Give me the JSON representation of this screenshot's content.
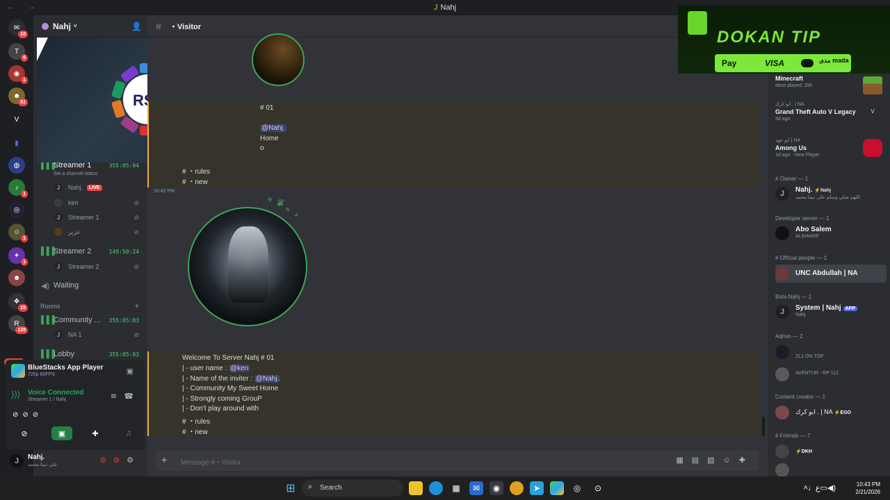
{
  "window": {
    "title": "Nahj"
  },
  "guild_badges": [
    "18",
    "6",
    "1",
    "61",
    "1",
    "1",
    "1",
    "15",
    "128"
  ],
  "guild_letter": "V",
  "guild_new": "NEW",
  "server": {
    "name": "Nahj"
  },
  "overlay": {
    "logo_text": "RSL"
  },
  "channels": {
    "streamer1": {
      "name": "Streamer 1",
      "time": "355:05:04",
      "status": "Set a channel status"
    },
    "streamer1_members": [
      {
        "name": "Nahj.",
        "live": "LIVE"
      },
      {
        "name": "ken"
      },
      {
        "name": "Streamer 1"
      },
      {
        "name": "عزيز"
      }
    ],
    "streamer2": {
      "name": "Streamer 2",
      "time": "149:50:24"
    },
    "streamer2_members": [
      {
        "name": "Streamer 2"
      }
    ],
    "waiting": "Waiting",
    "rooms_category": "Rooms",
    "community": {
      "name": "Community ...",
      "time": "355:05:03"
    },
    "community_members": [
      {
        "name": "NA 1"
      }
    ],
    "lobby": {
      "name": "Lobby",
      "time": "355:05:03"
    }
  },
  "panel": {
    "app_title": "BlueStacks App Player",
    "app_sub": "720p 60FPS",
    "voice_status": "Voice Connected",
    "voice_sub": "Streamer 1 / Nahj"
  },
  "user": {
    "name": "Nahj.",
    "status": "علي نبينا محمد"
  },
  "chat": {
    "channel": "・Visitor",
    "top_block": {
      "l1": "# 01",
      "l2": "@Nahj.",
      "l3": "Home",
      "l4": "o",
      "rules": "#  ・rules",
      "new": "#  ・new"
    },
    "timestamp": "10:42 PM",
    "avatar_tag": "N A H J",
    "message": {
      "l1": "Welcome To Server Nahj # 01",
      "l2_pre": "| - user name : ",
      "l2_mention": "@ken",
      "l3_pre": "| - Name of the inviter : ",
      "l3_mention": "@Nahj.",
      "l4": "| - Community My Sweet Home",
      "l5": "| - Strongly coming GrouP",
      "l6": "| - Don't play around with",
      "rules": "#  ・rules",
      "new": "#  ・new"
    },
    "composer_placeholder": "Message #・Visitor"
  },
  "activities": [
    {
      "game": "Minecraft",
      "sub": "Most played: 29h",
      "user": ""
    },
    {
      "game": "Grand Theft Auto V Legacy",
      "sub": "3d ago",
      "user": "ابو كرك . | NA"
    },
    {
      "game": "Among Us",
      "sub": "1d ago · New Player",
      "user": "ابو جهد | NA"
    }
  ],
  "members": {
    "owner_cat": "# Owner — 1",
    "owner": {
      "name": "Nahj.",
      "tag": "⚡Nahj",
      "status": "اللهم صلي وسلم على نبينا محمد"
    },
    "dev_cat": "Developer server — 1",
    "dev": {
      "name": "Abo Salem",
      "status": "ALSHARIF"
    },
    "official_cat": "# Official people — 1",
    "official": {
      "name": "UNC Abdullah | NA"
    },
    "bots_cat": "Bots-Nahj — 1",
    "bot": {
      "name": "System | Nahj",
      "badge": "APP",
      "status": "Nahj"
    },
    "admin_cat": "Admin — 2",
    "admin1": {
      "status": "ZL1 ON TOP"
    },
    "admin2": {
      "status": "AVENTUR - RP 112"
    },
    "creator_cat": "Content creator — 1",
    "creator": {
      "name": "ابو كرك . | NA",
      "tag": "⚡EGO"
    },
    "friends_cat": "# Friends — 7",
    "friend1": {
      "tag": "⚡DKH"
    }
  },
  "ad": {
    "brand": "DOKAN TIP",
    "pay1": " Pay",
    "pay2": "VISA",
    "pay3": "مدى mada"
  },
  "taskbar": {
    "search": "Search",
    "time": "10:43 PM",
    "date": "2/21/2026",
    "lang": "ع"
  },
  "colors": {
    "accent_green": "#3ba55d",
    "mention_bg": "#5865f2",
    "highlight_border": "#f0b232"
  }
}
